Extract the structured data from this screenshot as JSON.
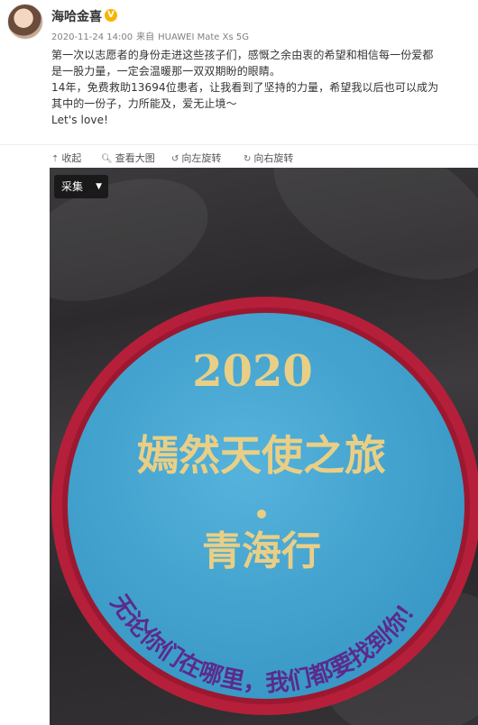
{
  "post": {
    "username": "海哈金喜",
    "timestamp": "2020-11-24 14:00",
    "source_prefix": "来自",
    "device": "HUAWEI Mate Xs 5G",
    "body_lines": [
      "第一次以志愿者的身份走进这些孩子们，感慨之余由衷的希望和相信每一份爱都",
      "是一股力量，一定会温暖那一双双期盼的眼睛。",
      "14年，免费救助13694位患者，让我看到了坚持的力量，希望我以后也可以成为",
      "其中的一份子，力所能及，爱无止境～",
      "Let's love!"
    ]
  },
  "toolbar": {
    "collapse": "收起",
    "view_large": "查看大图",
    "rotate_left": "向左旋转",
    "rotate_right": "向右旋转"
  },
  "image": {
    "collect_label": "采集",
    "patch_year": "2020",
    "patch_title": "嫣然天使之旅",
    "patch_subtitle": "青海行",
    "patch_arc_text": "无论你们在哪里，我们都要找到你！"
  },
  "colors": {
    "patch_blue": "#41a3cf",
    "patch_border": "#b51f3a",
    "embroidery_gold": "#e9cf86",
    "embroidery_purple": "#5b2a8c",
    "verified_badge": "#f7b500"
  }
}
